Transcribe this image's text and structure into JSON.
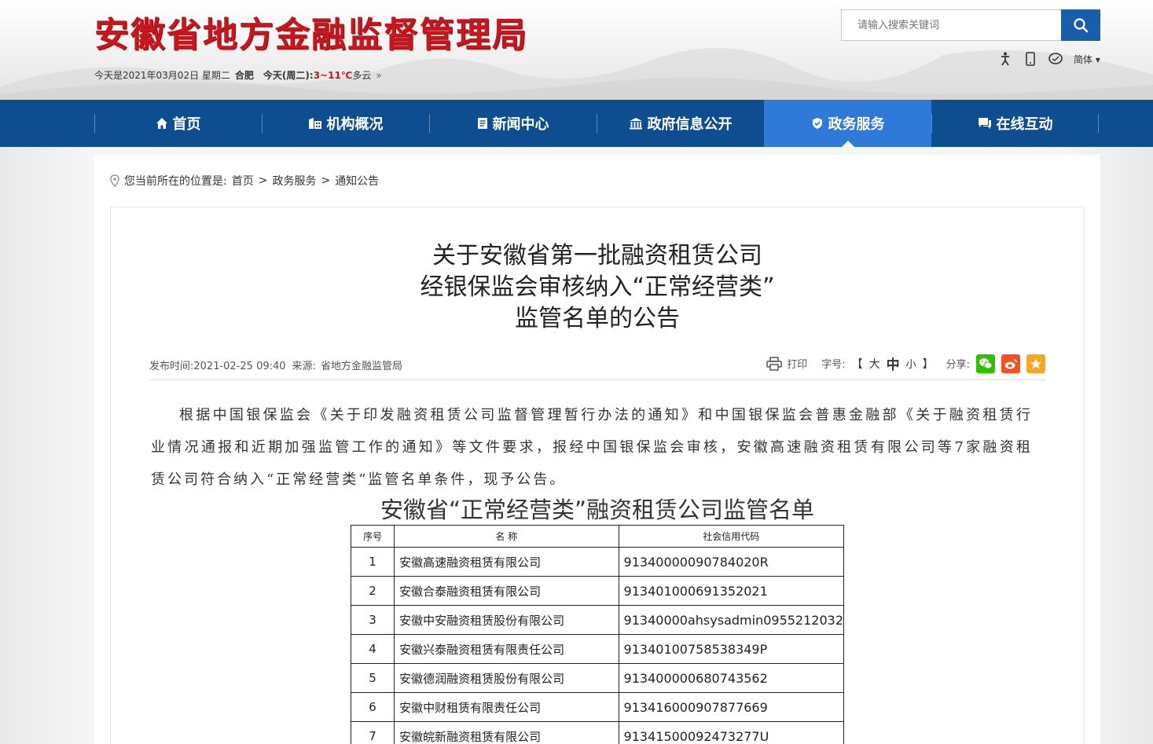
{
  "header": {
    "site_title": "安徽省地方金融监督管理局",
    "date": "今天是2021年03月02日 星期二",
    "city": "合肥",
    "weather_label": "今天(周二):",
    "temperature": "3~11℃",
    "weather": "多云",
    "more": "»",
    "search_placeholder": "请输入搜索关键词",
    "tools": {
      "accessibility_icon": "accessibility-icon",
      "mobile_icon": "mobile-icon",
      "wechat_icon": "message-icon",
      "language": "简体"
    }
  },
  "nav": {
    "items": [
      {
        "label": "首页",
        "icon": "home-icon"
      },
      {
        "label": "机构概况",
        "icon": "building-icon"
      },
      {
        "label": "新闻中心",
        "icon": "news-icon"
      },
      {
        "label": "政府信息公开",
        "icon": "government-icon"
      },
      {
        "label": "政务服务",
        "icon": "service-icon"
      },
      {
        "label": "在线互动",
        "icon": "chat-icon"
      }
    ],
    "active_index": 4
  },
  "breadcrumb": {
    "prefix": "您当前所在的位置是:",
    "items": [
      "首页",
      "政务服务",
      "通知公告"
    ],
    "sep": ">"
  },
  "article": {
    "title_lines": [
      "关于安徽省第一批融资租赁公司",
      "经银保监会审核纳入“正常经营类”",
      "监管名单的公告"
    ],
    "publish_label": "发布时间:",
    "publish_time": "2021-02-25 09:40",
    "source_label": "来源:",
    "source": "省地方金融监管局",
    "print_label": "打印",
    "font_label": "字号:",
    "font_open": "【",
    "font_large": "大",
    "font_mid": "中",
    "font_small": "小",
    "font_close": "】",
    "share_label": "分享:",
    "body": "根据中国银保监会《关于印发融资租赁公司监督管理暂行办法的通知》和中国银保监会普惠金融部《关于融资租赁行业情况通报和近期加强监管工作的通知》等文件要求，报经中国银保监会审核，安徽高速融资租赁有限公司等7家融资租赁公司符合纳入“正常经营类”监管名单条件，现予公告。",
    "table_title": "安徽省“正常经营类”融资租赁公司监管名单",
    "table": {
      "headers": [
        "序号",
        "名 称",
        "社会信用代码"
      ],
      "rows": [
        [
          "1",
          "安徽高速融资租赁有限公司",
          "91340000090784020R"
        ],
        [
          "2",
          "安徽合泰融资租赁有限公司",
          "913401000691352021"
        ],
        [
          "3",
          "安徽中安融资租赁股份有限公司",
          "91340000ahsysadmin0955212032"
        ],
        [
          "4",
          "安徽兴泰融资租赁有限责任公司",
          "91340100758538349P"
        ],
        [
          "5",
          "安徽德润融资租赁股份有限公司",
          "913400000680743562"
        ],
        [
          "6",
          "安徽中财租赁有限责任公司",
          "913416000907877669"
        ],
        [
          "7",
          "安徽皖新融资租赁有限公司",
          "91341500092473277U"
        ]
      ]
    }
  },
  "colors": {
    "brand_red": "#c8161d",
    "nav_blue": "#0f4d91",
    "nav_active": "#2f7ad8",
    "search_btn": "#1a5da8",
    "wechat_green": "#2dc100",
    "weibo_orange": "#f4511e",
    "fav_orange": "#f6a623"
  }
}
